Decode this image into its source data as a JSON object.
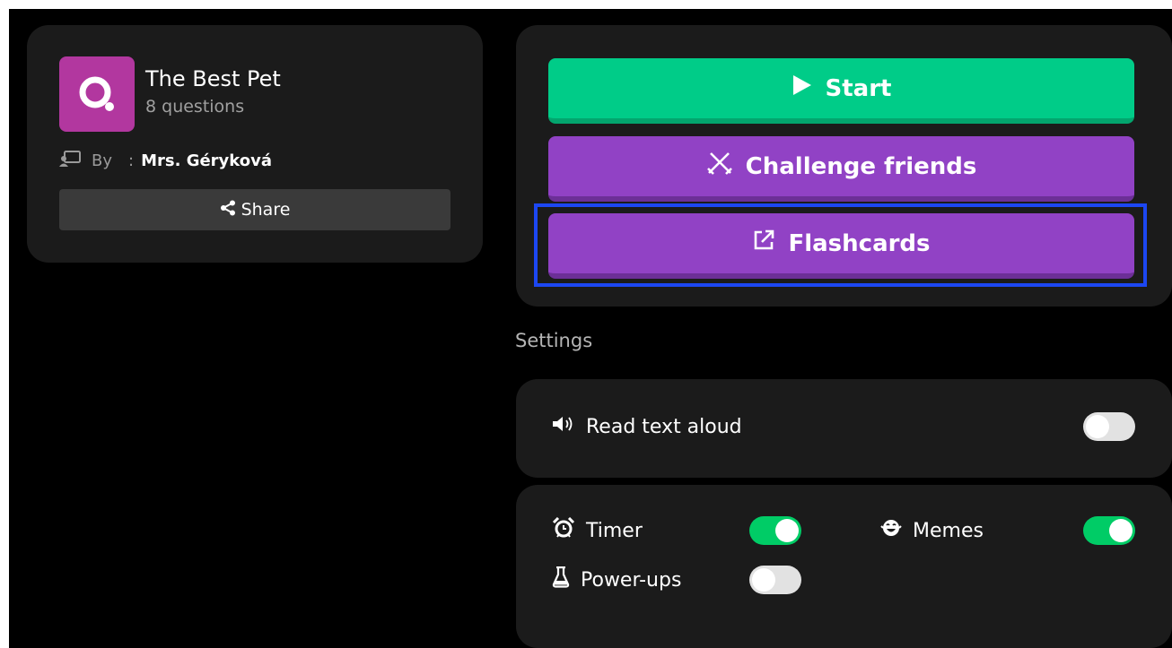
{
  "quiz": {
    "title": "The Best Pet",
    "question_count": "8 questions",
    "by_label": "By",
    "separator": ":",
    "author": "Mrs. Géryková",
    "share_label": "Share"
  },
  "actions": {
    "start_label": "Start",
    "challenge_label": "Challenge friends",
    "flashcards_label": "Flashcards"
  },
  "settings": {
    "heading": "Settings",
    "read_aloud": {
      "label": "Read text aloud",
      "on": false
    },
    "timer": {
      "label": "Timer",
      "on": true
    },
    "memes": {
      "label": "Memes",
      "on": true
    },
    "powerups": {
      "label": "Power-ups",
      "on": false
    }
  },
  "colors": {
    "start": "#00cc88",
    "purple": "#9142c5",
    "logo": "#b2379f",
    "highlight": "#1c47f2",
    "toggle_on": "#00cc66"
  }
}
